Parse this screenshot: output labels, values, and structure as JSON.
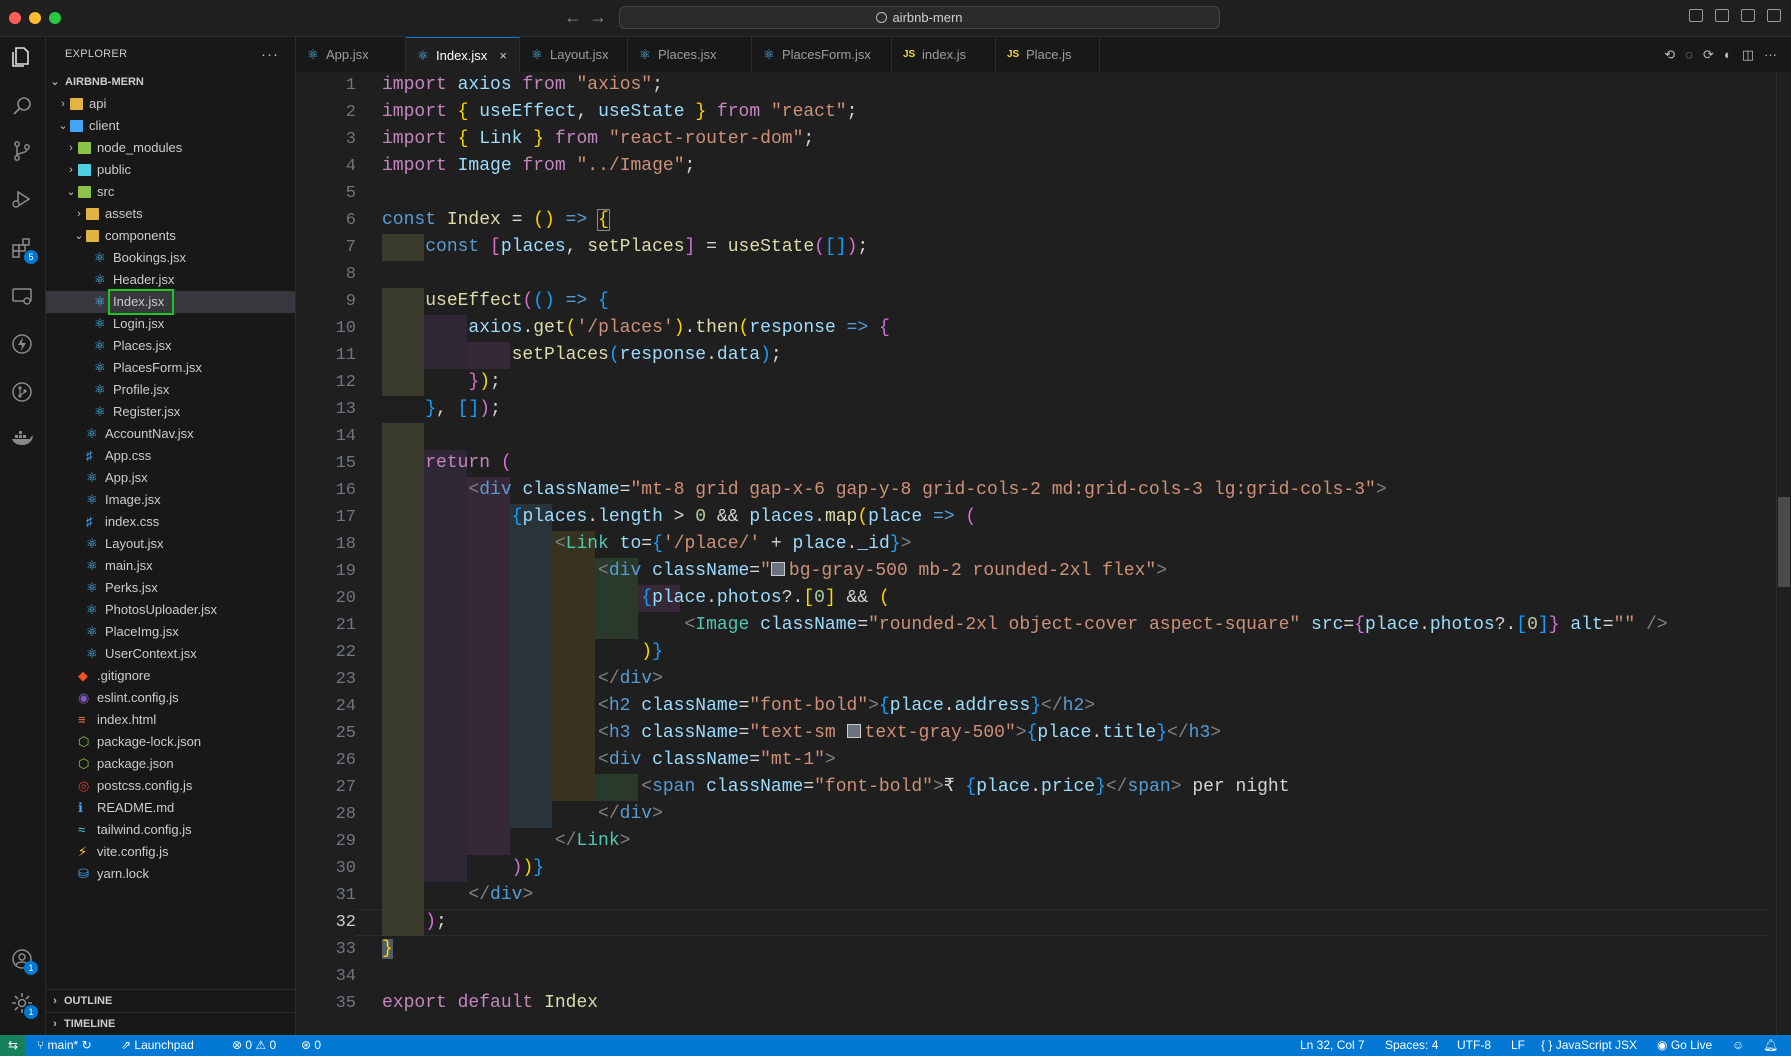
{
  "titlebar": {
    "search_text": "airbnb-mern",
    "back": "←",
    "forward": "→"
  },
  "activity_bar": {
    "extensions_badge": "5",
    "accounts_badge": "1",
    "settings_badge": "1"
  },
  "explorer": {
    "title": "EXPLORER",
    "more": "···",
    "root": "AIRBNB-MERN",
    "items": [
      {
        "label": "api",
        "type": "folder"
      },
      {
        "label": "client",
        "type": "folder"
      },
      {
        "label": "node_modules",
        "type": "folder"
      },
      {
        "label": "public",
        "type": "folder"
      },
      {
        "label": "src",
        "type": "folder"
      },
      {
        "label": "assets",
        "type": "folder"
      },
      {
        "label": "components",
        "type": "folder"
      },
      {
        "label": "Bookings.jsx",
        "type": "react"
      },
      {
        "label": "Header.jsx",
        "type": "react"
      },
      {
        "label": "Index.jsx",
        "type": "react"
      },
      {
        "label": "Login.jsx",
        "type": "react"
      },
      {
        "label": "Places.jsx",
        "type": "react"
      },
      {
        "label": "PlacesForm.jsx",
        "type": "react"
      },
      {
        "label": "Profile.jsx",
        "type": "react"
      },
      {
        "label": "Register.jsx",
        "type": "react"
      },
      {
        "label": "AccountNav.jsx",
        "type": "react"
      },
      {
        "label": "App.css",
        "type": "css"
      },
      {
        "label": "App.jsx",
        "type": "react"
      },
      {
        "label": "Image.jsx",
        "type": "react"
      },
      {
        "label": "index.css",
        "type": "css"
      },
      {
        "label": "Layout.jsx",
        "type": "react"
      },
      {
        "label": "main.jsx",
        "type": "react"
      },
      {
        "label": "Perks.jsx",
        "type": "react"
      },
      {
        "label": "PhotosUploader.jsx",
        "type": "react"
      },
      {
        "label": "PlaceImg.jsx",
        "type": "react"
      },
      {
        "label": "UserContext.jsx",
        "type": "react"
      },
      {
        "label": ".gitignore",
        "type": "git"
      },
      {
        "label": "eslint.config.js",
        "type": "eslint"
      },
      {
        "label": "index.html",
        "type": "html"
      },
      {
        "label": "package-lock.json",
        "type": "npm"
      },
      {
        "label": "package.json",
        "type": "npm"
      },
      {
        "label": "postcss.config.js",
        "type": "postcss"
      },
      {
        "label": "README.md",
        "type": "info"
      },
      {
        "label": "tailwind.config.js",
        "type": "tailwind"
      },
      {
        "label": "vite.config.js",
        "type": "vite"
      },
      {
        "label": "yarn.lock",
        "type": "yarn"
      }
    ],
    "outline": "OUTLINE",
    "timeline": "TIMELINE"
  },
  "tabs": [
    {
      "label": "App.jsx",
      "type": "react"
    },
    {
      "label": "Index.jsx",
      "type": "react",
      "active": true,
      "close": "×"
    },
    {
      "label": "Layout.jsx",
      "type": "react"
    },
    {
      "label": "Places.jsx",
      "type": "react"
    },
    {
      "label": "PlacesForm.jsx",
      "type": "react"
    },
    {
      "label": "index.js",
      "type": "js"
    },
    {
      "label": "Place.js",
      "type": "js"
    }
  ],
  "editor": {
    "line_numbers": [
      "1",
      "2",
      "3",
      "4",
      "5",
      "6",
      "7",
      "8",
      "9",
      "10",
      "11",
      "12",
      "13",
      "14",
      "15",
      "16",
      "17",
      "18",
      "19",
      "20",
      "21",
      "22",
      "23",
      "24",
      "25",
      "26",
      "27",
      "28",
      "29",
      "30",
      "31",
      "32",
      "33",
      "34",
      "35"
    ],
    "current_line": "32"
  },
  "statusbar": {
    "branch": "main*",
    "launchpad": "Launchpad",
    "errors": "0",
    "warnings": "0",
    "ports": "0",
    "position": "Ln 32, Col 7",
    "spaces": "Spaces: 4",
    "encoding": "UTF-8",
    "eol": "LF",
    "language": "JavaScript JSX",
    "golive": "Go Live"
  }
}
